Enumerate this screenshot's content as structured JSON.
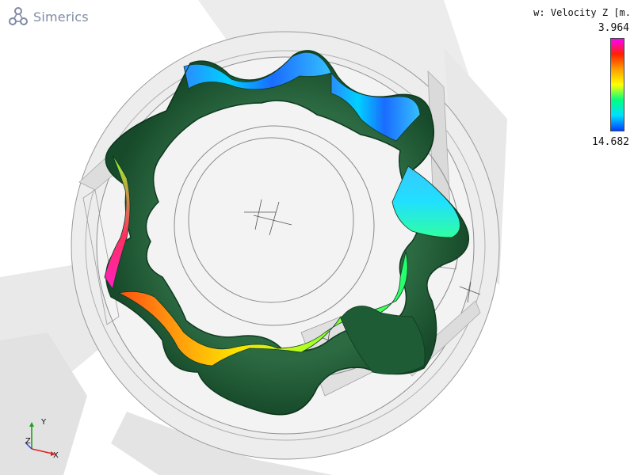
{
  "app": {
    "logo_text": "Simerics"
  },
  "legend": {
    "title": "w: Velocity Z [m.",
    "max_value": "3.964",
    "min_value": "14.682",
    "colormap": [
      "#ff00ff",
      "#ff2000",
      "#ffa000",
      "#ffff00",
      "#00ff80",
      "#00e0ff",
      "#0040ff"
    ]
  },
  "axes_triad": {
    "x_label": "X",
    "y_label": "Y",
    "z_label": "Z",
    "x_color": "#e02020",
    "y_color": "#20a020",
    "z_color": "#2040e0"
  },
  "scene": {
    "rotor_color": "#1f5a34",
    "housing_color": "#e6e6e6",
    "edge_color": "#8a8a8a"
  }
}
